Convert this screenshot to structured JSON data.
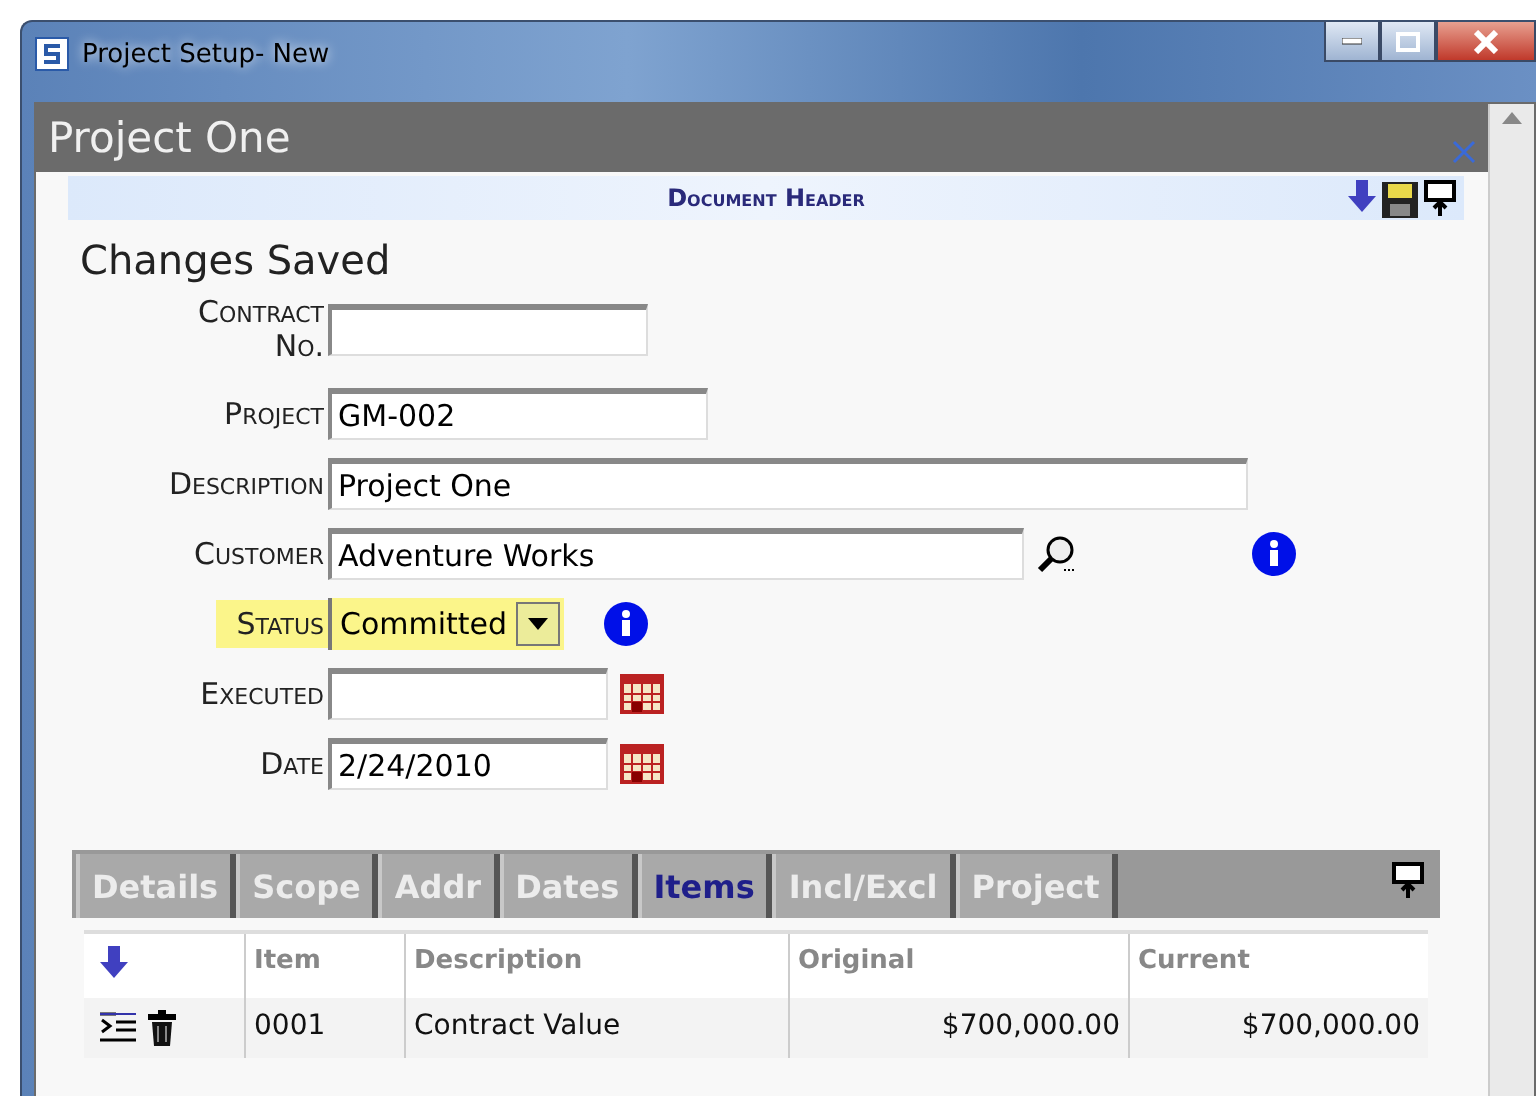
{
  "window": {
    "title": "Project Setup- New"
  },
  "panel": {
    "title": "Project One"
  },
  "header": {
    "title": "Document Header"
  },
  "message": "Changes Saved",
  "fields": [
    {
      "kind": "text",
      "label": "Contract No.",
      "highlighted": false
    },
    {
      "kind": "text",
      "label": "Project",
      "value": "GM-002",
      "highlighted": false
    },
    {
      "kind": "text",
      "label": "Description",
      "value": "Project One",
      "highlighted": false
    },
    {
      "kind": "lookup",
      "label": "Customer",
      "value": "Adventure Works",
      "highlighted": false
    },
    {
      "kind": "select",
      "label": "Status",
      "value": "Committed",
      "highlighted": true
    },
    {
      "kind": "date",
      "label": "Executed",
      "highlighted": false
    },
    {
      "kind": "date",
      "label": "Date",
      "value": "2/24/2010",
      "highlighted": false
    }
  ],
  "tabs": [
    {
      "label": "Details",
      "selected": false
    },
    {
      "label": "Scope",
      "selected": false
    },
    {
      "label": "Addr",
      "selected": false
    },
    {
      "label": "Dates",
      "selected": false
    },
    {
      "label": "Items",
      "selected": true
    },
    {
      "label": "Incl/Excl",
      "selected": false
    },
    {
      "label": "Project",
      "selected": false
    }
  ],
  "table": {
    "columns": [
      "Item",
      "Description",
      "Original",
      "Current"
    ],
    "rows": [
      {
        "item": "0001",
        "description": "Contract Value",
        "original": "$700,000.00",
        "current": "$700,000.00"
      }
    ]
  }
}
